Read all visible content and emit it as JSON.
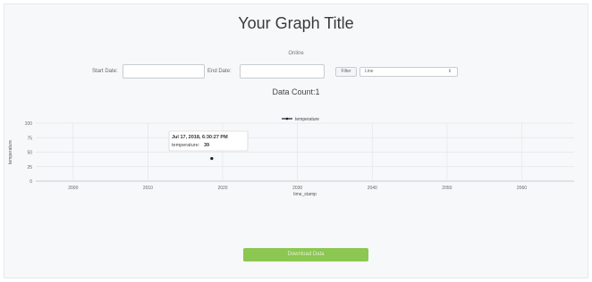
{
  "page": {
    "title": "Your Graph Title",
    "status": "Online"
  },
  "filters": {
    "start_label": "Start Date:",
    "end_label": "End Date:",
    "start_value": "",
    "end_value": "",
    "filter_button": "Filter",
    "chart_type_selected": "Line"
  },
  "summary": {
    "data_count": "Data Count:1"
  },
  "tooltip": {
    "header": "Jul 17, 2018, 6:30:27 PM",
    "label": "temperature:",
    "value": "39"
  },
  "download_button": "Download Data",
  "colors": {
    "accent": "#8bc751",
    "series": "#1a1a2e",
    "grid": "#e3e6ea"
  },
  "chart_data": {
    "type": "line",
    "xlabel": "time_stamp",
    "ylabel": "temperature",
    "xlim": [
      1995,
      2067
    ],
    "ylim": [
      0,
      100
    ],
    "x_ticks": [
      2000,
      2010,
      2020,
      2030,
      2040,
      2050,
      2060
    ],
    "y_ticks": [
      0,
      25,
      50,
      75,
      100
    ],
    "grid": true,
    "legend": "top-center",
    "series": [
      {
        "name": "temperature",
        "x": [
          "2018-07-17T18:30:27"
        ],
        "y": [
          39
        ]
      }
    ]
  }
}
